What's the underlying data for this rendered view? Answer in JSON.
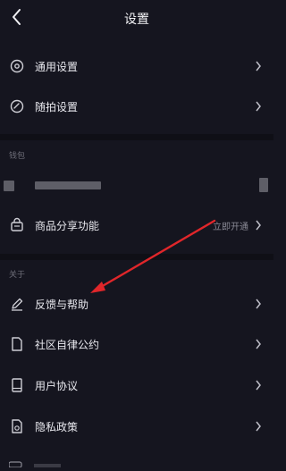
{
  "header": {
    "title": "设置",
    "back_icon": "back-chevron-icon"
  },
  "groups": {
    "general": [
      {
        "label": "通用设置",
        "icon": "settings-gear-icon"
      },
      {
        "label": "随拍设置",
        "icon": "camera-circle-icon"
      }
    ],
    "wallet": {
      "section_label": "钱包",
      "share_item": {
        "label": "商品分享功能",
        "icon": "shop-bag-icon",
        "action": "立即开通"
      }
    },
    "about": {
      "section_label": "关于",
      "items": [
        {
          "label": "反馈与帮助",
          "icon": "pencil-icon"
        },
        {
          "label": "社区自律公约",
          "icon": "document-icon"
        },
        {
          "label": "用户协议",
          "icon": "book-icon"
        },
        {
          "label": "隐私政策",
          "icon": "privacy-doc-icon"
        }
      ]
    }
  },
  "annotation": {
    "arrow_color": "#e0262a"
  },
  "colors": {
    "background": "#15151f",
    "divider": "#0f0f16",
    "text": "#e8e8ee",
    "muted": "#8a8a96"
  }
}
